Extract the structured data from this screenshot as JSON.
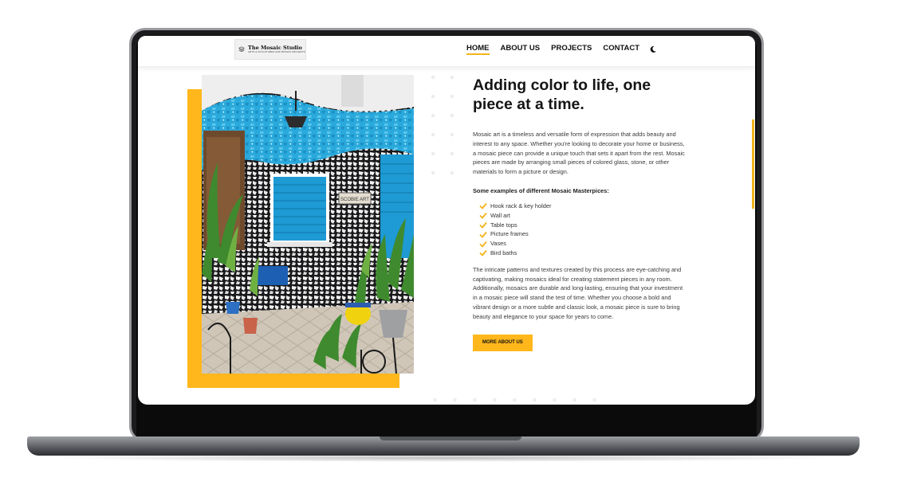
{
  "brand": {
    "name": "The Mosaic Studio",
    "tagline": "ARTS & SCULPTURES AND MOSAIC PROJECTS"
  },
  "nav": {
    "items": [
      {
        "label": "HOME",
        "active": true
      },
      {
        "label": "ABOUT US",
        "active": false
      },
      {
        "label": "PROJECTS",
        "active": false
      },
      {
        "label": "CONTACT",
        "active": false
      }
    ],
    "theme_toggle_icon": "moon-icon"
  },
  "hero": {
    "heading": "Adding color to life, one piece at a time.",
    "intro": "Mosaic art is a timeless and versatile form of expression that adds beauty and interest to any space. Whether you're looking to decorate your home or business, a mosaic piece can provide a unique touch that sets it apart from the rest. Mosaic pieces are made by arranging small pieces of colored glass, stone, or other materials to form a picture or design.",
    "examples_heading": "Some examples of different Mosaic Masterpices:",
    "examples": [
      "Hook rack & key holder",
      "Wall art",
      "Table tops",
      "Picture frames",
      "Vases",
      "Bird baths"
    ],
    "closing": "The intricate patterns and textures created by this process are eye-catching and captivating, making mosaics ideal for creating statement pieces in any room. Additionally, mosaics are durable and long-lasting, ensuring that your investment in a mosaic piece will stand the test of time. Whether you choose a bold and vibrant design or a more subtle and classic look, a mosaic piece is sure to bring beauty and elegance to your space for years to come.",
    "cta_label": "MORE ABOUT US"
  },
  "photo_sign": "SCOBIE ART",
  "colors": {
    "accent": "#ffb71b",
    "text": "#151515",
    "mosaic_blue": "#2aa9dc"
  }
}
